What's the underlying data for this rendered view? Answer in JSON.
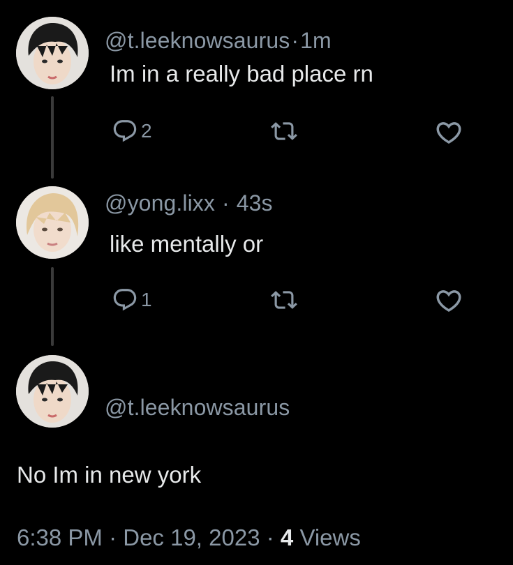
{
  "tweets": [
    {
      "handle": "@t.leeknowsaurus",
      "time": "1m",
      "text": "Im in a really bad place rn",
      "replies": "2",
      "avatar_icon": "dark-hair-avatar"
    },
    {
      "handle": "@yong.lixx",
      "time": "43s",
      "text": "like mentally or",
      "replies": "1",
      "avatar_icon": "blonde-hair-avatar"
    }
  ],
  "main_tweet": {
    "handle": "@t.leeknowsaurus",
    "text": "No Im in new york",
    "time": "6:38 PM",
    "date": "Dec 19, 2023",
    "views_count": "4",
    "views_label": "Views",
    "avatar_icon": "dark-hair-avatar"
  },
  "separator": "·",
  "colors": {
    "background": "#000000",
    "primary_text": "#e7e9ea",
    "secondary_text": "#8b98a5",
    "thread_line": "#3a3a3a"
  },
  "icons": [
    "reply-icon",
    "retweet-icon",
    "like-icon"
  ]
}
